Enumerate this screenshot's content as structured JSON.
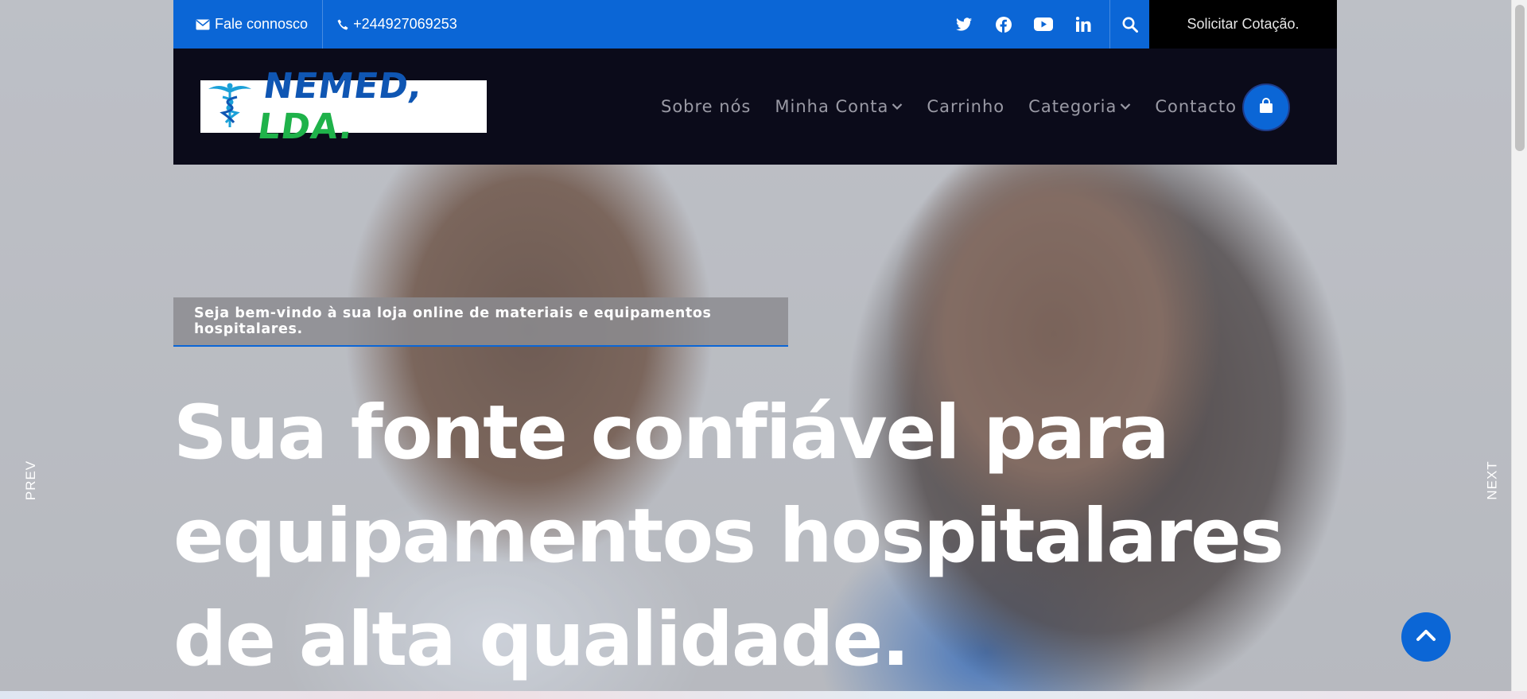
{
  "topbar": {
    "contact_label": "Fale connosco",
    "phone": "+244927069253",
    "social": [
      "twitter-icon",
      "facebook-icon",
      "youtube-icon",
      "linkedin-icon"
    ],
    "quote_label": "Solicitar Cotação."
  },
  "logo": {
    "part1": "NEMED,",
    "part2": " LDA."
  },
  "nav": {
    "items": [
      {
        "label": "Sobre nós",
        "dropdown": false
      },
      {
        "label": "Minha Conta",
        "dropdown": true
      },
      {
        "label": "Carrinho",
        "dropdown": false
      },
      {
        "label": "Categoria",
        "dropdown": true
      },
      {
        "label": "Contacto",
        "dropdown": false
      }
    ]
  },
  "hero": {
    "welcome": "Seja bem-vindo à sua loja online de materiais e equipamentos hospitalares.",
    "headline": "Sua fonte confiável para equipamentos hospitalares de alta qualidade.",
    "prev_label": "PREV",
    "next_label": "NEXT"
  },
  "colors": {
    "accent": "#0b66d6",
    "nav_bg": "#0b0b1a",
    "logo_blue": "#0f56b3",
    "logo_green": "#1fb24a"
  }
}
